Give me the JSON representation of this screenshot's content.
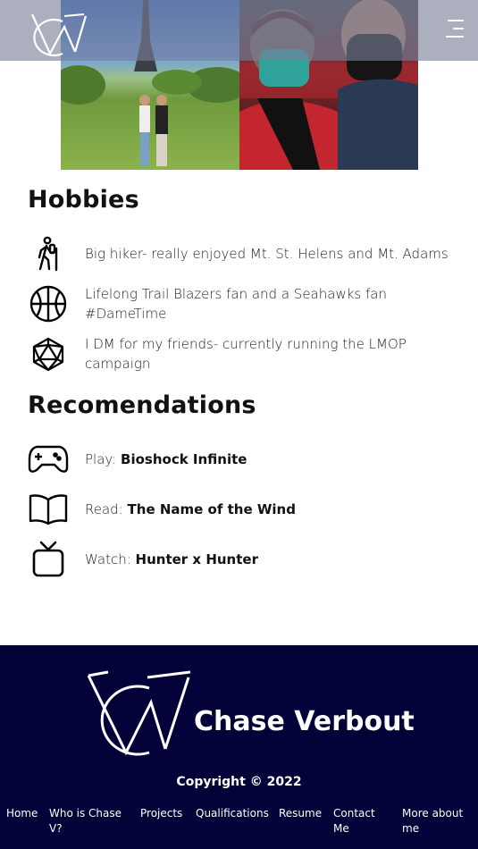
{
  "header": {
    "logo_icon": "cv-monogram-logo",
    "menu_icon": "hamburger-menu-icon"
  },
  "photos": [
    {
      "icon": "photo-eiffel-tower"
    },
    {
      "icon": "photo-basketball-game-selfie"
    }
  ],
  "hobbies": {
    "title": "Hobbies",
    "items": [
      {
        "icon": "hiker-icon",
        "text": "Big hiker- really enjoyed Mt. St. Helens and Mt. Adams"
      },
      {
        "icon": "basketball-icon",
        "text": "Lifelong Trail Blazers fan and a Seahawks fan #DameTime"
      },
      {
        "icon": "d20-dice-icon",
        "text": "I DM for my friends- currently running the LMOP campaign"
      }
    ]
  },
  "recommendations": {
    "title": "Recomendations",
    "items": [
      {
        "icon": "gamepad-icon",
        "prefix": "Play:",
        "title": "Bioshock Infinite"
      },
      {
        "icon": "open-book-icon",
        "prefix": "Read:",
        "title": "The Name of the Wind"
      },
      {
        "icon": "tv-icon",
        "prefix": "Watch:",
        "title": "Hunter x Hunter"
      }
    ]
  },
  "footer": {
    "name": "Chase Verbout",
    "copyright": "Copyright © 2022",
    "nav": [
      "Home",
      "Who is Chase V?",
      "Projects",
      "Qualifications",
      "Resume",
      "Contact Me",
      "More about me"
    ]
  },
  "colors": {
    "footer_bg": "#020238",
    "header_overlay": "#787e96",
    "text": "#111111"
  }
}
